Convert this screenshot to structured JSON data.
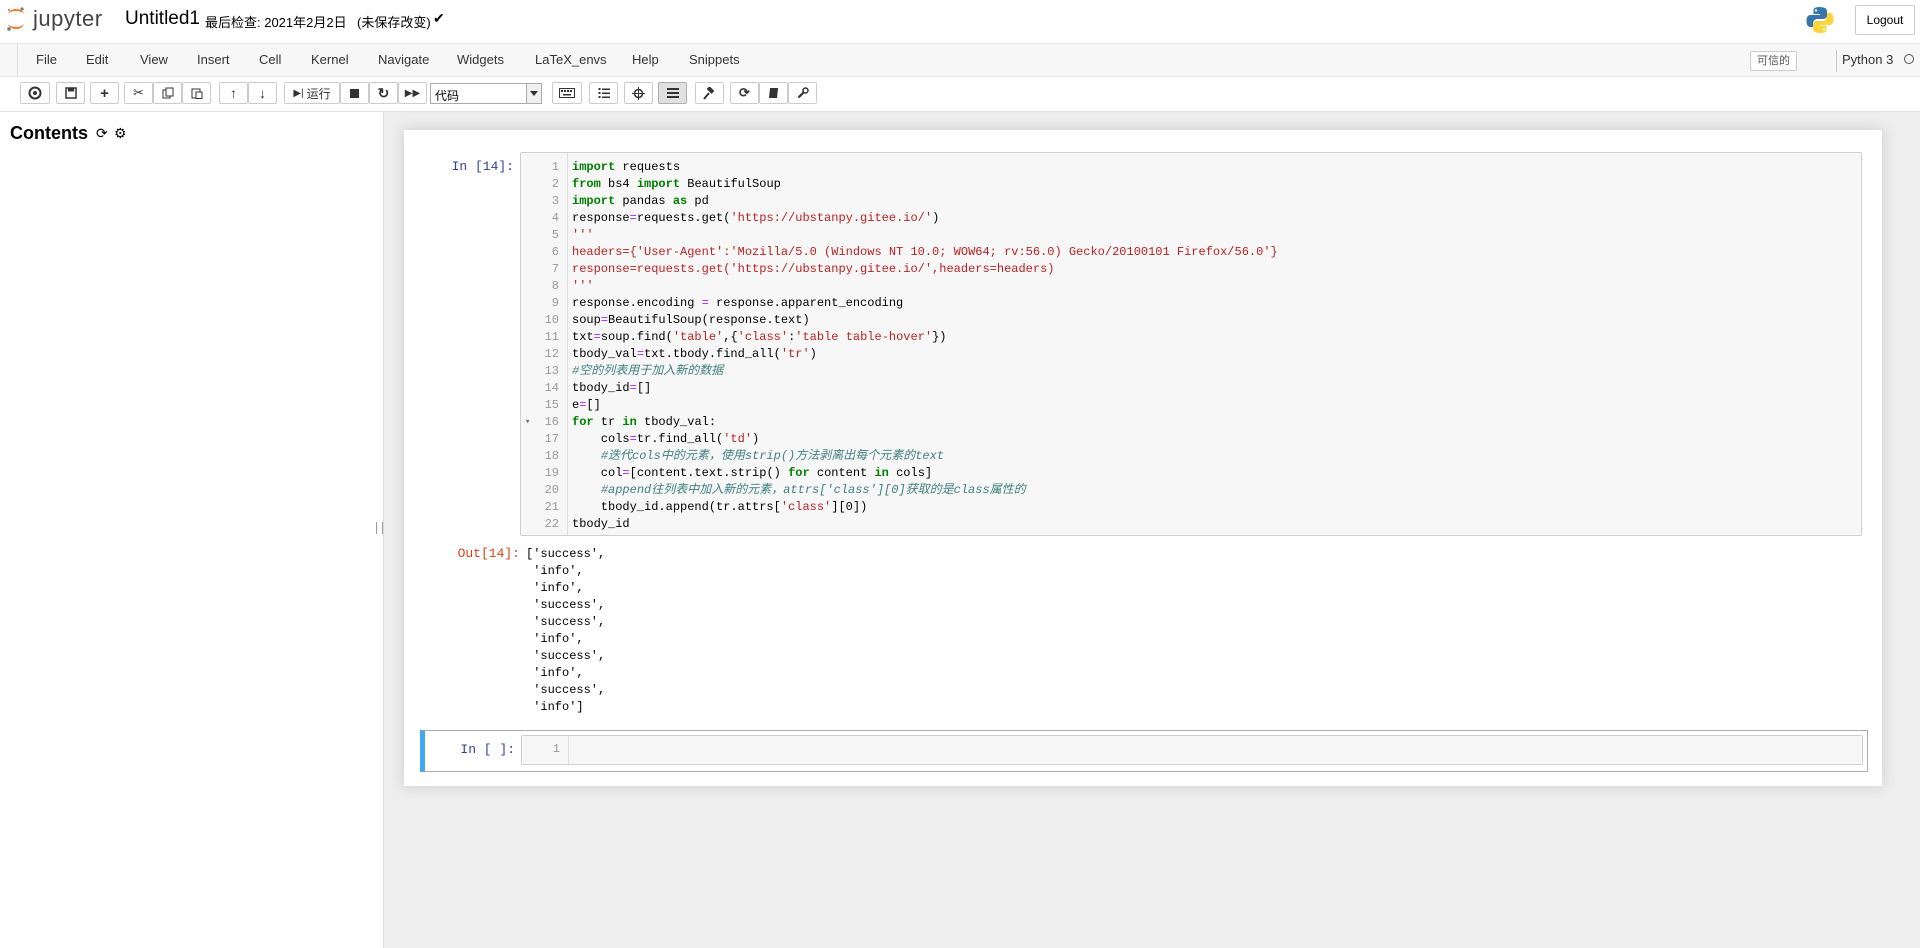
{
  "header": {
    "logo_text": "jupyter",
    "notebook_title": "Untitled1",
    "checkpoint": "最后检查: 2021年2月2日",
    "autosave": "(未保存改变)",
    "logout_label": "Logout"
  },
  "menubar": {
    "items": [
      "File",
      "Edit",
      "View",
      "Insert",
      "Cell",
      "Kernel",
      "Navigate",
      "Widgets",
      "LaTeX_envs",
      "Help",
      "Snippets"
    ],
    "trusted": "可信的",
    "kernel_name": "Python 3"
  },
  "toolbar": {
    "run_label": "运行",
    "cell_type": "代码",
    "icons": [
      "save-icon",
      "plus-icon",
      "cut-icon",
      "copy-icon",
      "paste-icon",
      "arrow-up-icon",
      "arrow-down-icon",
      "step-forward-icon",
      "stop-icon",
      "restart-icon",
      "fast-forward-icon",
      "keyboard-icon",
      "list-ol-icon",
      "crosshairs-icon",
      "list-icon",
      "gavel-icon",
      "refresh-icon",
      "book-icon",
      "wrench-icon"
    ]
  },
  "toc": {
    "title": "Contents"
  },
  "cells": [
    {
      "in_prompt": "In [14]:",
      "out_prompt": "Out[14]:",
      "line_numbers": [
        "1",
        "2",
        "3",
        "4",
        "5",
        "6",
        "7",
        "8",
        "9",
        "10",
        "11",
        "12",
        "13",
        "14",
        "15",
        "16",
        "17",
        "18",
        "19",
        "20",
        "21",
        "22"
      ],
      "output_lines": [
        "['success',",
        " 'info',",
        " 'info',",
        " 'success',",
        " 'success',",
        " 'info',",
        " 'success',",
        " 'info',",
        " 'success',",
        " 'info']"
      ]
    },
    {
      "in_prompt": "In [ ]:",
      "line_numbers": [
        "1"
      ]
    }
  ],
  "colors": {
    "keyword": "#008000",
    "string": "#ba2121",
    "comment": "#408080",
    "in_prompt": "#303f9f",
    "out_prompt": "#d84315",
    "selected_cell_border": "#42a5f5"
  }
}
